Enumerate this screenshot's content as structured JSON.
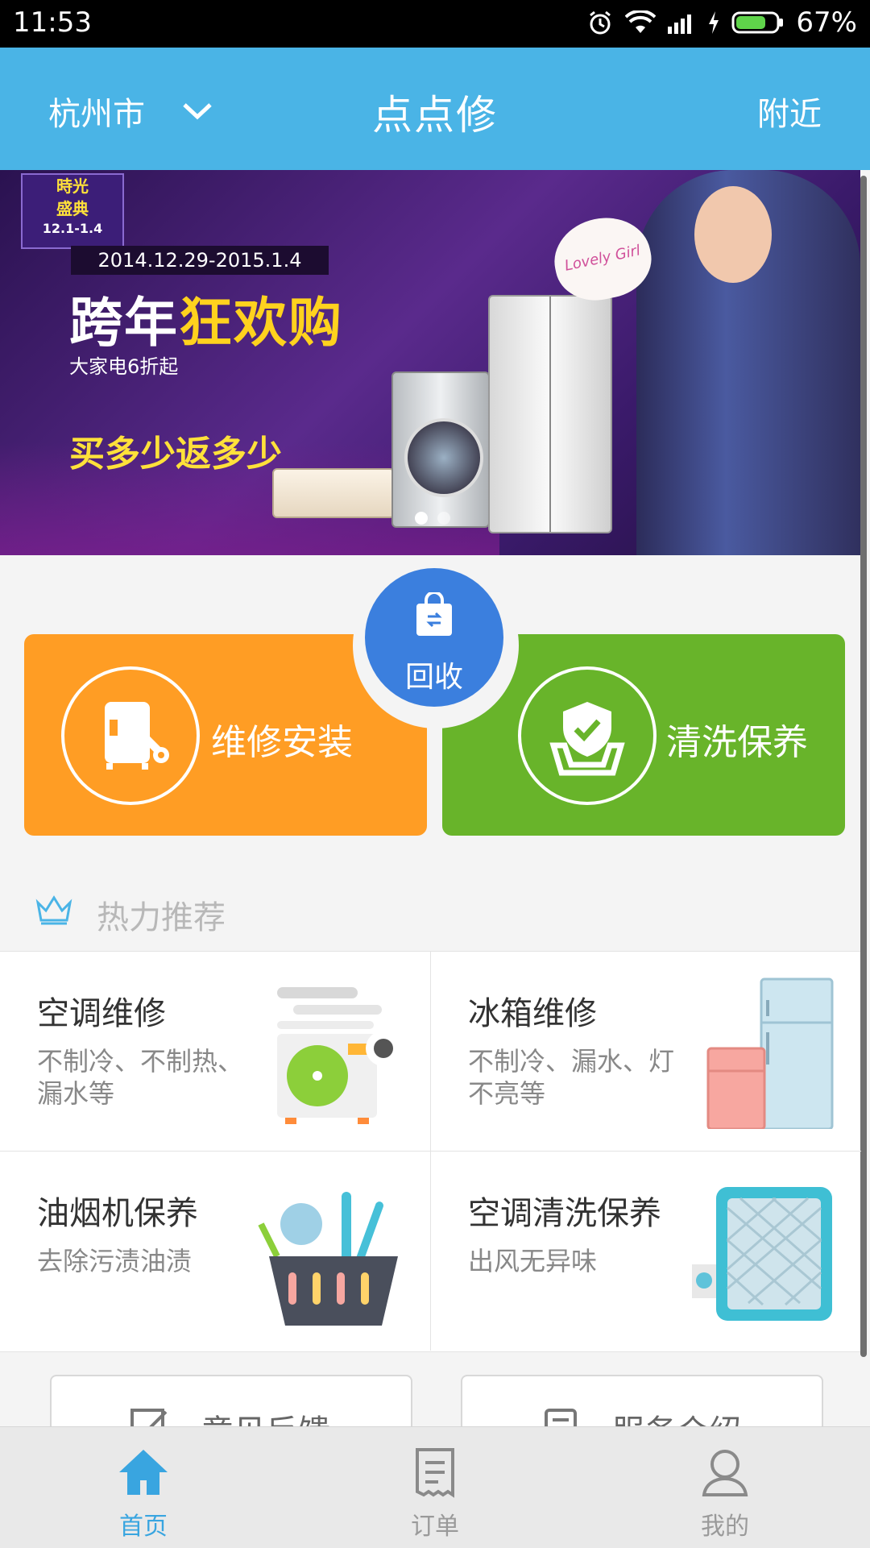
{
  "status_bar": {
    "time": "11:53",
    "battery": "67%"
  },
  "header": {
    "city": "杭州市",
    "title": "点点修",
    "nearby": "附近"
  },
  "banner": {
    "badge_line1": "時光",
    "badge_line2": "盛典",
    "badge_line3": "12.1-1.4",
    "date": "2014.12.29-2015.1.4",
    "headline_part1": "跨年",
    "headline_part2": "狂欢购",
    "subline": "大家电6折起",
    "promo": "买多少返多少",
    "heart_text": "Lovely Girl",
    "slide_count": 2,
    "active_slide": 0
  },
  "services": {
    "repair_label": "维修安装",
    "clean_label": "清洗保养",
    "recycle_label": "回收"
  },
  "hot": {
    "title": "热力推荐",
    "items": [
      {
        "name": "空调维修",
        "desc": "不制冷、不制热、漏水等"
      },
      {
        "name": "冰箱维修",
        "desc": "不制冷、漏水、灯不亮等"
      },
      {
        "name": "油烟机保养",
        "desc": "去除污渍油渍"
      },
      {
        "name": "空调清洗保养",
        "desc": "出风无异味"
      }
    ]
  },
  "actions": {
    "feedback": "意见反馈",
    "intro": "服务介绍"
  },
  "tabs": [
    {
      "label": "首页",
      "icon": "home-icon",
      "active": true
    },
    {
      "label": "订单",
      "icon": "receipt-icon",
      "active": false
    },
    {
      "label": "我的",
      "icon": "user-icon",
      "active": false
    }
  ],
  "colors": {
    "primary": "#4ab4e6",
    "orange": "#ff9d24",
    "green": "#68b42a",
    "blue": "#3b7fde"
  }
}
